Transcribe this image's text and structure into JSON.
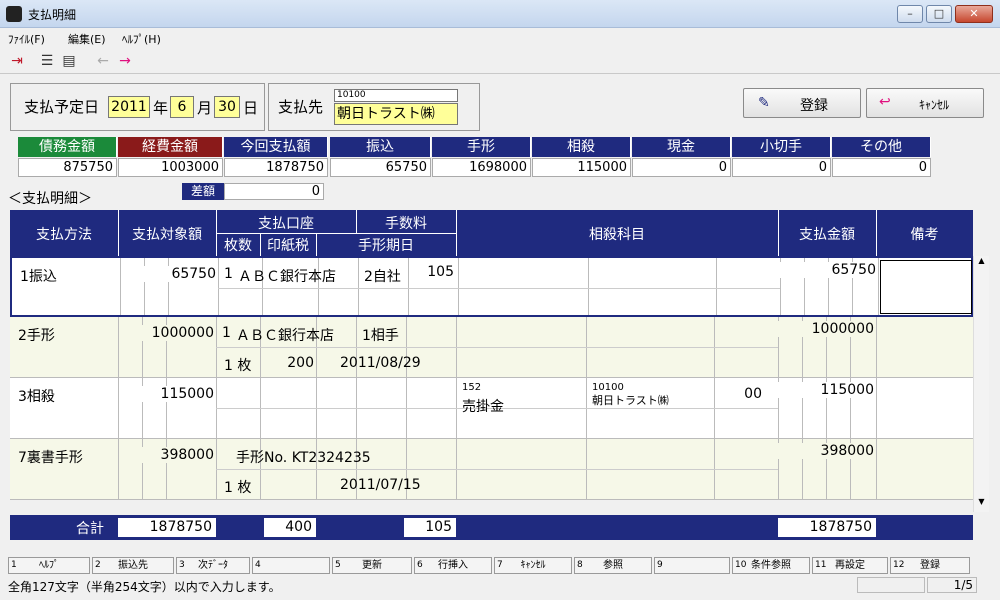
{
  "window": {
    "title": "支払明細"
  },
  "menu": [
    {
      "label": "ﾌｧｲﾙ(F)"
    },
    {
      "label": "編集(E)"
    },
    {
      "label": "ﾍﾙﾌﾟ(H)"
    }
  ],
  "toolbar_icons": [
    "exit-icon",
    "list-icon",
    "detail-icon",
    "back-arrow-icon",
    "forward-arrow-icon"
  ],
  "header": {
    "date_label": "支払予定日",
    "year": "2011",
    "year_unit": "年",
    "month": "6",
    "month_unit": "月",
    "day": "30",
    "day_unit": "日",
    "payee_label": "支払先",
    "payee_code": "10100",
    "payee_name": "朝日トラスト㈱",
    "register_label": "登録",
    "cancel_label": "ｷｬﾝｾﾙ"
  },
  "summary": {
    "labels": [
      "債務金額",
      "経費金額",
      "今回支払額",
      "振込",
      "手形",
      "相殺",
      "現金",
      "小切手",
      "その他"
    ],
    "label_colors": [
      "#1b8a3a",
      "#8a1a1a",
      "#1f2a7f",
      "#1f2a7f",
      "#1f2a7f",
      "#1f2a7f",
      "#1f2a7f",
      "#1f2a7f",
      "#1f2a7f"
    ],
    "values": [
      "875750",
      "1003000",
      "1878750",
      "65750",
      "1698000",
      "115000",
      "0",
      "0",
      "0"
    ],
    "diff_label": "差額",
    "diff_value": "0"
  },
  "section_title": "＜支払明細＞",
  "grid": {
    "headers": {
      "method": "支払方法",
      "target": "支払対象額",
      "account": "支払口座",
      "fee": "手数料",
      "count": "枚数",
      "stamp": "印紙税",
      "due": "手形期日",
      "offset": "相殺科目",
      "amount": "支払金額",
      "note": "備考"
    },
    "rows": [
      {
        "method": "1振込",
        "target": "65750",
        "no": "1",
        "bank": "ＡＢＣ銀行本店",
        "fee_type": "2自社",
        "fee": "105",
        "count": "",
        "stamp": "",
        "due": "",
        "sub_code1": "",
        "subject": "",
        "sub_code2": "",
        "partner": "",
        "num": "",
        "amount": "65750"
      },
      {
        "method": "2手形",
        "target": "1000000",
        "no": "1",
        "bank": "ＡＢＣ銀行本店",
        "fee_type": "1相手",
        "fee": "",
        "count": "1 枚",
        "stamp": "200",
        "due": "2011/08/29",
        "sub_code1": "",
        "subject": "",
        "sub_code2": "",
        "partner": "",
        "num": "",
        "amount": "1000000"
      },
      {
        "method": "3相殺",
        "target": "115000",
        "no": "",
        "bank": "",
        "fee_type": "",
        "fee": "",
        "count": "",
        "stamp": "",
        "due": "",
        "sub_code1": "152",
        "subject": "売掛金",
        "sub_code2": "10100",
        "partner": "朝日トラスト㈱",
        "num": "00",
        "amount": "115000"
      },
      {
        "method": "7裏書手形",
        "target": "398000",
        "no": "",
        "bank": "手形No. KT2324235",
        "fee_type": "",
        "fee": "",
        "count": "1 枚",
        "stamp": "",
        "due": "2011/07/15",
        "sub_code1": "",
        "subject": "",
        "sub_code2": "",
        "partner": "",
        "num": "",
        "amount": "398000"
      }
    ]
  },
  "totals": {
    "label": "合計",
    "target": "1878750",
    "stamp": "400",
    "fee": "105",
    "amount": "1878750"
  },
  "fkeys": [
    {
      "n": "1",
      "label": "ﾍﾙﾌﾟ"
    },
    {
      "n": "2",
      "label": "振込先"
    },
    {
      "n": "3",
      "label": "次ﾃﾞｰﾀ"
    },
    {
      "n": "4",
      "label": ""
    },
    {
      "n": "5",
      "label": "更新"
    },
    {
      "n": "6",
      "label": "行挿入"
    },
    {
      "n": "7",
      "label": "ｷｬﾝｾﾙ"
    },
    {
      "n": "8",
      "label": "参照"
    },
    {
      "n": "9",
      "label": ""
    },
    {
      "n": "10",
      "label": "条件参照"
    },
    {
      "n": "11",
      "label": "再設定"
    },
    {
      "n": "12",
      "label": "登録"
    }
  ],
  "status": {
    "message": "全角127文字（半角254文字）以内で入力します。",
    "page": "1/5"
  }
}
